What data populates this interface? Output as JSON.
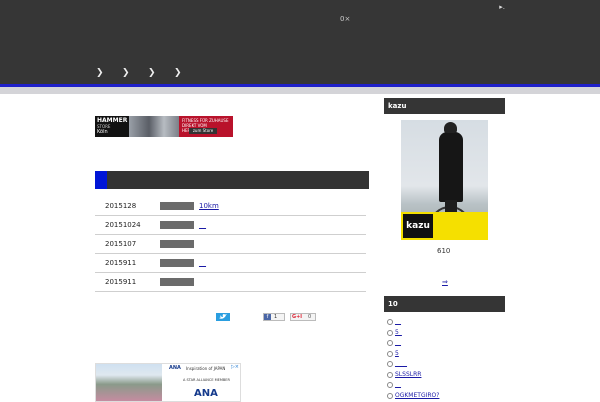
{
  "header": {
    "corner_mark": "▸.",
    "counter": "0×",
    "nav_items": [
      "❯",
      "❯",
      "❯",
      "❯"
    ]
  },
  "ad_top": {
    "brand": "HAMMER",
    "brand_sub": "STORE",
    "city": "Köln",
    "tagline": "FITNESS FÜR ZUHAUSE DIREKT VOM HERSTELLER",
    "cta": "zum Store"
  },
  "articles": [
    {
      "date": "2015128",
      "link": "10km"
    },
    {
      "date": "20151024",
      "link": "__"
    },
    {
      "date": "2015107",
      "link": ""
    },
    {
      "date": "2015911",
      "link": "__"
    },
    {
      "date": "2015911",
      "link": ""
    }
  ],
  "share": {
    "tweet_icon": "twitter-icon",
    "facebook_count": "1",
    "gplus_label": "G+l",
    "gplus_count": "0"
  },
  "ad_bottom": {
    "airline": "ANA",
    "tagline": "Inspiration of JAPAN",
    "alliance": "A STAR ALLIANCE MEMBER",
    "big": "ANA",
    "close": "▷×"
  },
  "sidebar": {
    "profile_title": "kazu",
    "profile_badge": "kazu",
    "profile_number": "610",
    "profile_link": "⇒",
    "popular_title": "10",
    "popular_items": [
      "__",
      "5_",
      "__",
      "5",
      "____",
      "SLSSLRR",
      "__",
      "OGKMETGIRO?"
    ]
  },
  "colors": {
    "header_bg": "#363636",
    "accent_blue": "#0015d6",
    "link": "#1a1aa6"
  }
}
